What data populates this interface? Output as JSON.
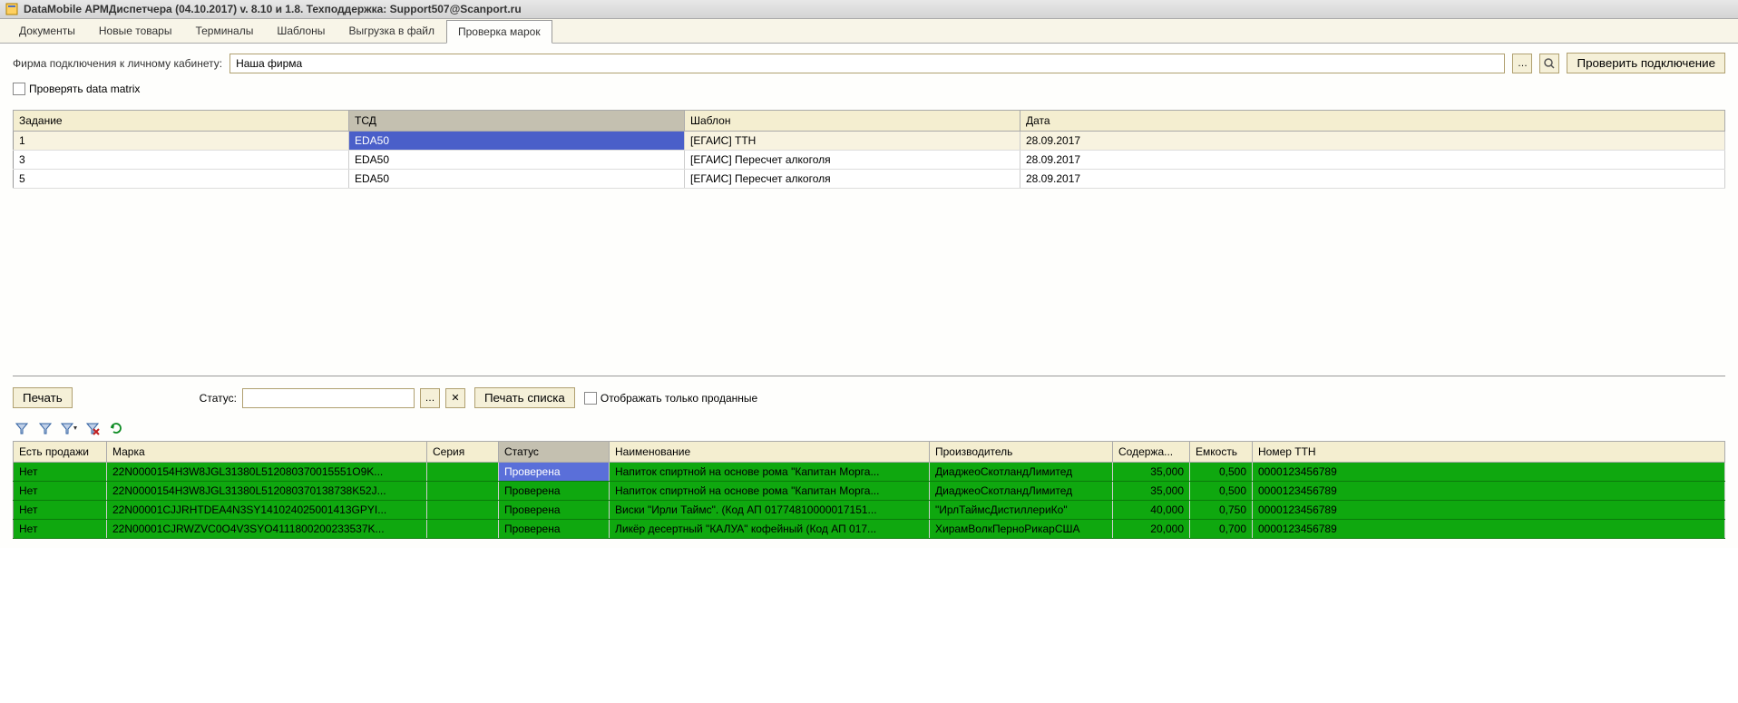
{
  "title": "DataMobile АРМДиспетчера (04.10.2017) v. 8.10 и 1.8. Техподдержка: Support507@Scanport.ru",
  "tabs": [
    "Документы",
    "Новые товары",
    "Терминалы",
    "Шаблоны",
    "Выгрузка в файл",
    "Проверка марок"
  ],
  "active_tab": 5,
  "firm_label": "Фирма подключения к личному кабинету:",
  "firm_value": "Наша фирма",
  "check_conn_btn": "Проверить подключение",
  "check_dm_label": "Проверять data matrix",
  "table1": {
    "headers": [
      "Задание",
      "ТСД",
      "Шаблон",
      "Дата"
    ],
    "rows": [
      {
        "task": "1",
        "tsd": "EDA50",
        "tpl": "[ЕГАИС] ТТН",
        "date": "28.09.2017"
      },
      {
        "task": "3",
        "tsd": "EDA50",
        "tpl": "[ЕГАИС] Пересчет алкоголя",
        "date": "28.09.2017"
      },
      {
        "task": "5",
        "tsd": "EDA50",
        "tpl": "[ЕГАИС] Пересчет алкоголя",
        "date": "28.09.2017"
      }
    ]
  },
  "print_btn": "Печать",
  "status_label": "Статус:",
  "status_value": "",
  "print_list_btn": "Печать списка",
  "show_sold_label": "Отображать только проданные",
  "table2": {
    "headers": [
      "Есть продажи",
      "Марка",
      "Серия",
      "Статус",
      "Наименование",
      "Производитель",
      "Содержа...",
      "Емкость",
      "Номер ТТН"
    ],
    "rows": [
      {
        "sale": "Нет",
        "mark": "22N0000154H3W8JGL31380L512080370015551O9K...",
        "ser": "",
        "stat": "Проверена",
        "name": "Напиток спиртной на основе рома \"Капитан Морга...",
        "prod": "ДиаджеоСкотландЛимитед",
        "cont": "35,000",
        "cap": "0,500",
        "ttn": "0000123456789"
      },
      {
        "sale": "Нет",
        "mark": "22N0000154H3W8JGL31380L512080370138738K52J...",
        "ser": "",
        "stat": "Проверена",
        "name": "Напиток спиртной на основе рома \"Капитан Морга...",
        "prod": "ДиаджеоСкотландЛимитед",
        "cont": "35,000",
        "cap": "0,500",
        "ttn": "0000123456789"
      },
      {
        "sale": "Нет",
        "mark": "22N00001CJJRHTDEA4N3SY141024025001413GPYI...",
        "ser": "",
        "stat": "Проверена",
        "name": "Виски \"Ирли Таймс\". (Код АП 01774810000017151...",
        "prod": "\"ИрлТаймсДистиллериКо\"",
        "cont": "40,000",
        "cap": "0,750",
        "ttn": "0000123456789"
      },
      {
        "sale": "Нет",
        "mark": "22N00001CJRWZVC0O4V3SYO4111800200233537K...",
        "ser": "",
        "stat": "Проверена",
        "name": "Ликёр десертный \"КАЛУА\" кофейный (Код АП 017...",
        "prod": "ХирамВолкПерноРикарСША",
        "cont": "20,000",
        "cap": "0,700",
        "ttn": "0000123456789"
      }
    ]
  }
}
